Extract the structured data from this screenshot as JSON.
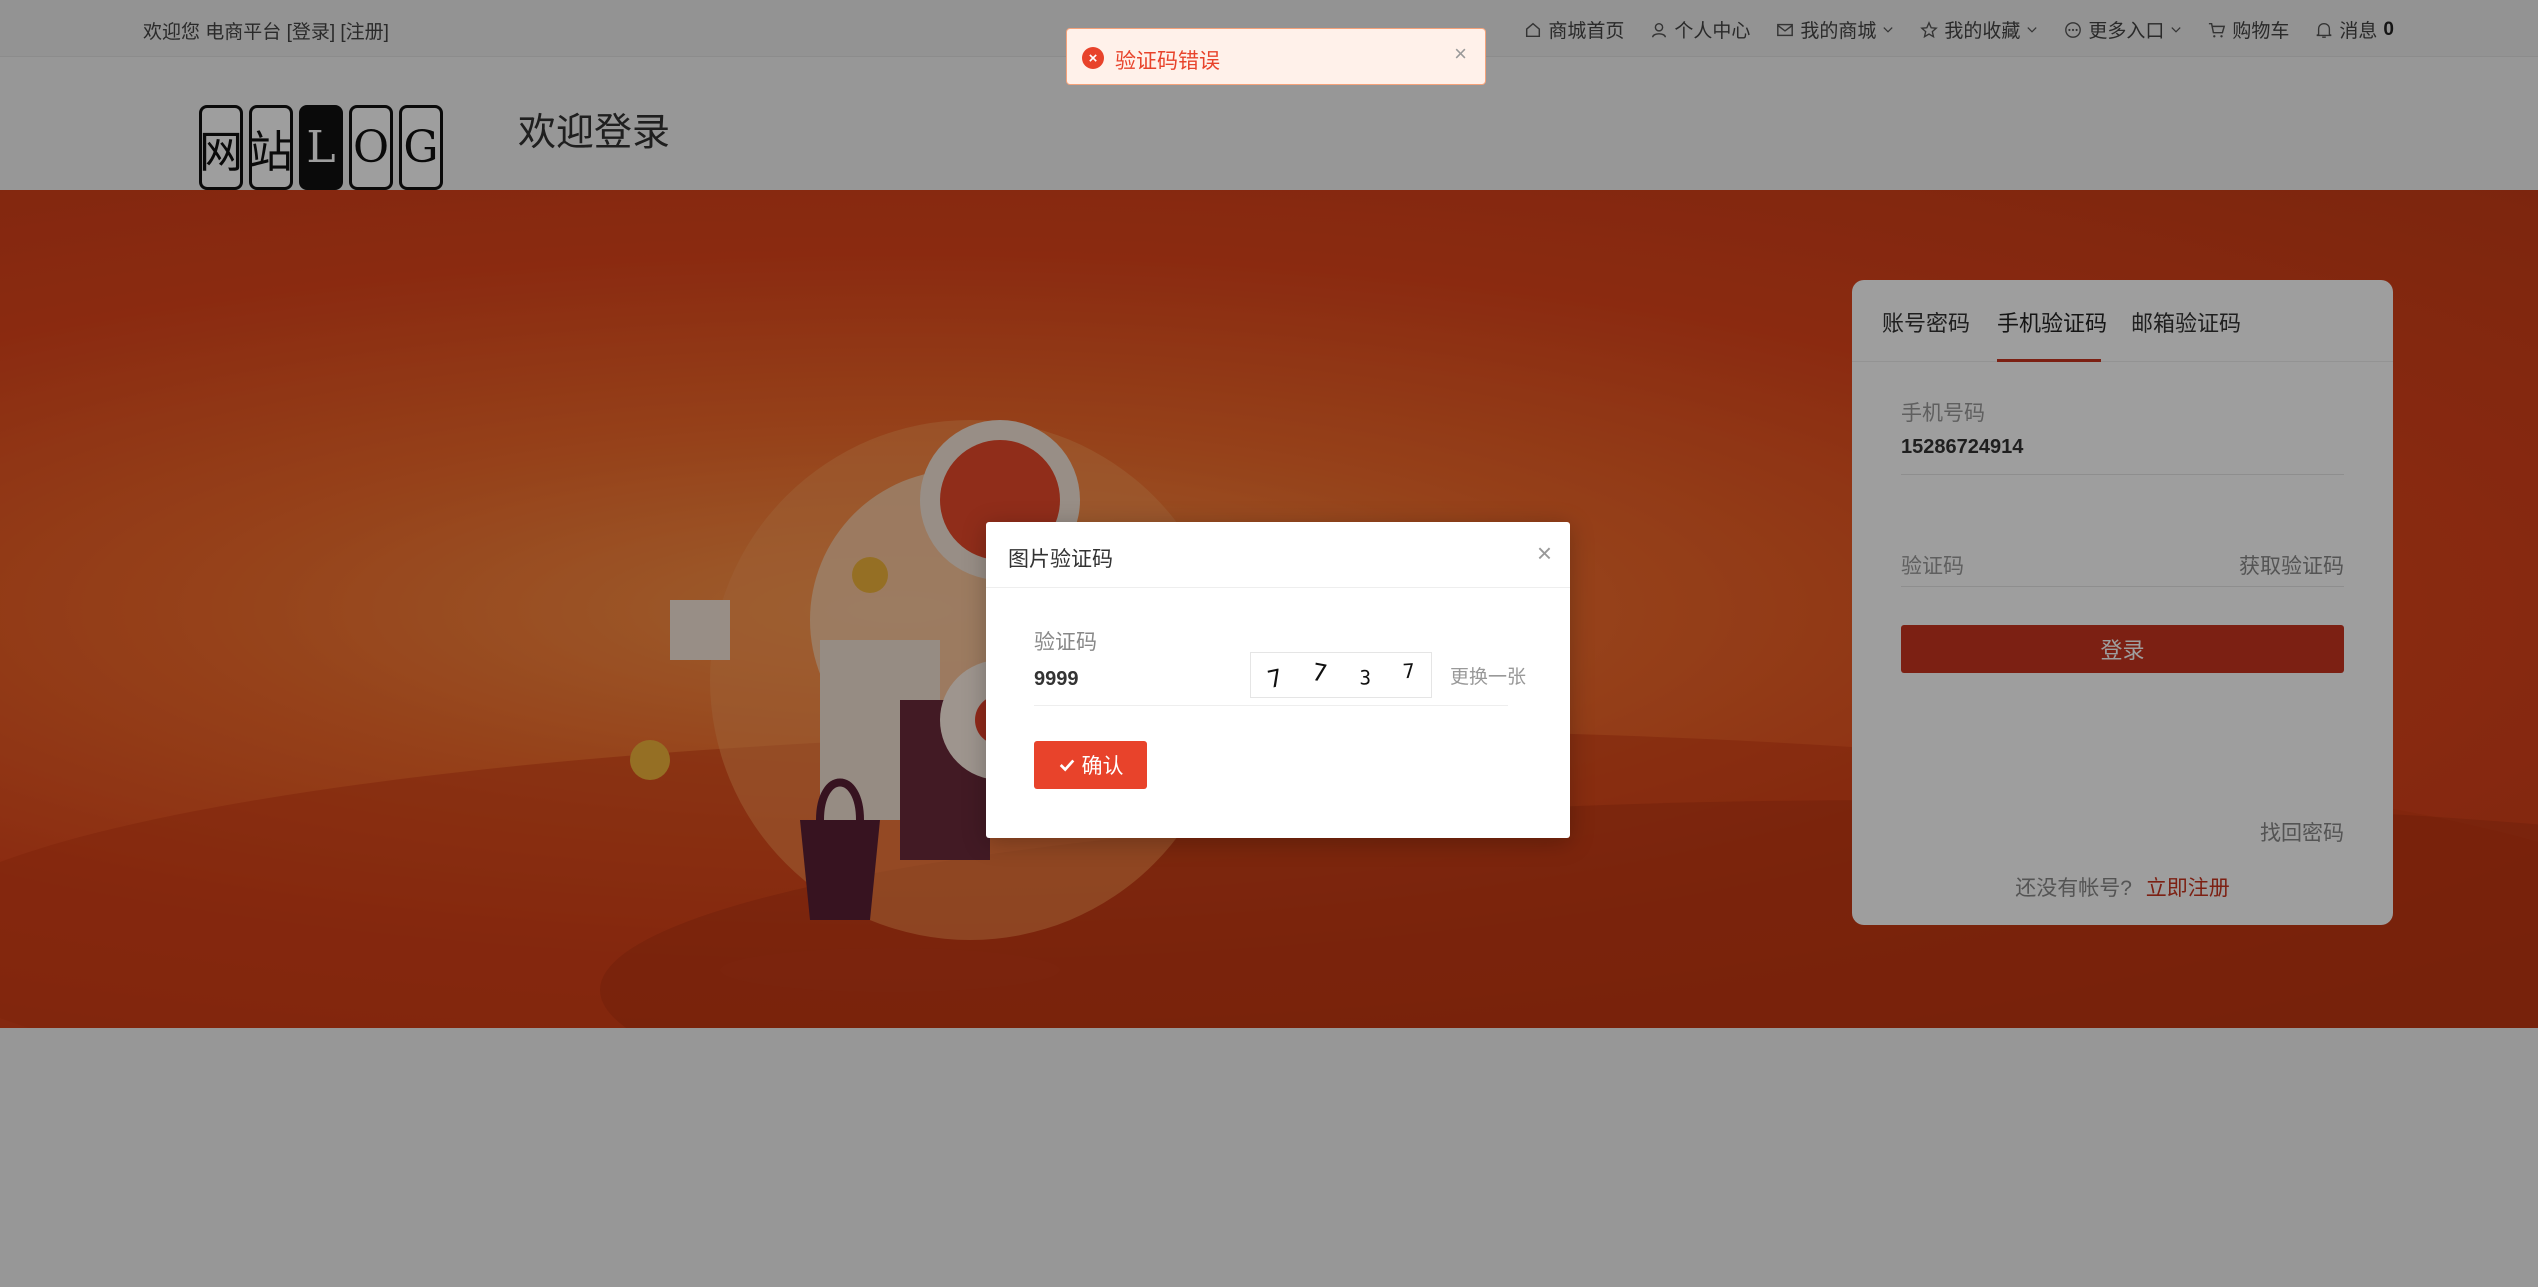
{
  "topbar": {
    "welcome_prefix": "欢迎您 电商平台",
    "login_link": "[登录]",
    "register_link": "[注册]",
    "nav": [
      {
        "label": "商城首页",
        "icon": "home-icon"
      },
      {
        "label": "个人中心",
        "icon": "user-icon"
      },
      {
        "label": "我的商城",
        "icon": "mail-icon",
        "dropdown": true
      },
      {
        "label": "我的收藏",
        "icon": "star-icon",
        "dropdown": true
      },
      {
        "label": "更多入口",
        "icon": "more-icon",
        "dropdown": true
      },
      {
        "label": "购物车",
        "icon": "cart-icon"
      },
      {
        "label": "消息",
        "icon": "bell-icon",
        "count": "0"
      }
    ]
  },
  "header": {
    "logo_chars": [
      "网",
      "站",
      "L",
      "O",
      "G"
    ],
    "title": "欢迎登录"
  },
  "login": {
    "tabs": [
      "账号密码",
      "手机验证码",
      "邮箱验证码"
    ],
    "active_tab": 1,
    "phone_label": "手机号码",
    "phone_value": "15286724914",
    "code_placeholder": "验证码",
    "get_code": "获取验证码",
    "submit": "登录",
    "forgot": "找回密码",
    "no_account": "还没有帐号?",
    "register_now": "立即注册"
  },
  "modal": {
    "title": "图片验证码",
    "label": "验证码",
    "value": "9999",
    "captcha_chars": [
      "7",
      "7",
      "3",
      "7"
    ],
    "refresh": "更换一张",
    "confirm": "确认"
  },
  "toast": {
    "message": "验证码错误"
  },
  "colors": {
    "brand": "#c8341f",
    "accent": "#e8432b",
    "banner": "#e0451b"
  }
}
